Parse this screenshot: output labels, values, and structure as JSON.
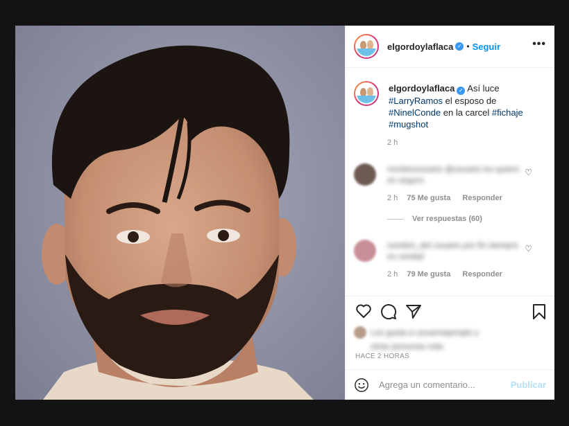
{
  "header": {
    "username": "elgordoylaflaca",
    "follow_label": "Seguir",
    "separator": "•",
    "more_label": "•••"
  },
  "caption": {
    "username": "elgordoylaflaca",
    "text_1": "Así luce",
    "tag_1": "#LarryRamos",
    "text_2": "el esposo de",
    "tag_2": "#NinelConde",
    "text_3": "en la carcel",
    "tag_3": "#fichaje",
    "tag_4": "#mugshot",
    "time": "2 h"
  },
  "comments": [
    {
      "blurred_text": "nombreusuario @usuario los quiero es seguro",
      "time": "2 h",
      "likes": "75 Me gusta",
      "reply_label": "Responder",
      "view_replies": "Ver respuestas (60)"
    },
    {
      "blurred_text": "nombre_del usuario por fin siempre es verdad",
      "time": "2 h",
      "likes": "79 Me gusta",
      "reply_label": "Responder"
    }
  ],
  "likes_blurred": {
    "line_1": "Les gusta a usuarioejemplo y",
    "line_2": "otras personas más"
  },
  "posted_ago": "HACE 2 HORAS",
  "composer": {
    "placeholder": "Agrega un comentario...",
    "publish_label": "Publicar"
  },
  "colors": {
    "accent": "#0095f6",
    "hashtag": "#00376b",
    "muted": "#8e8e8e",
    "backdrop": "#131313"
  }
}
